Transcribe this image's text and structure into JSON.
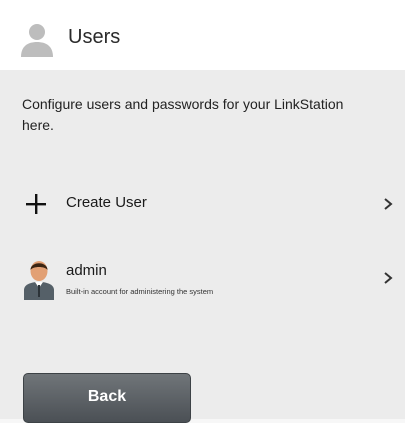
{
  "header": {
    "title": "Users",
    "icon": "user-silhouette-icon"
  },
  "main": {
    "description": "Configure users and passwords for your LinkStation here.",
    "create_user": {
      "label": "Create User",
      "icon": "plus-icon"
    },
    "users": [
      {
        "name": "admin",
        "description": "Built-in account for administering the system",
        "icon": "admin-avatar-icon"
      }
    ],
    "back_label": "Back"
  },
  "colors": {
    "header_bg": "#ffffff",
    "content_bg": "#ececec",
    "button_bg": "#5a5f64",
    "button_text": "#ffffff"
  }
}
